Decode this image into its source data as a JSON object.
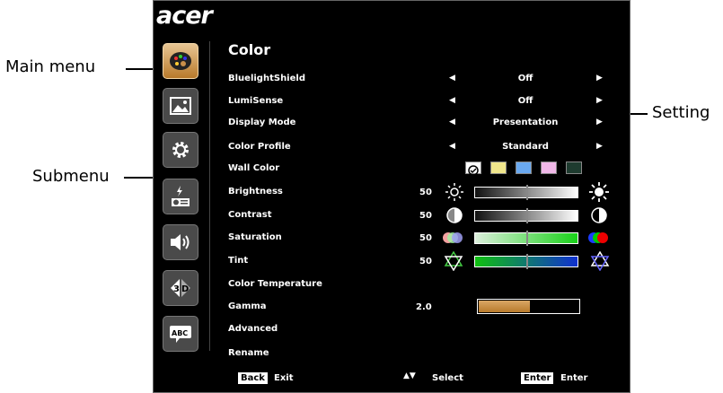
{
  "callouts": {
    "main_menu": "Main menu",
    "submenu": "Submenu",
    "setting": "Setting"
  },
  "osd": {
    "logo": "acer",
    "title": "Color",
    "nav_icons": [
      "color-palette-icon",
      "image-icon",
      "gear-icon",
      "power-settings-icon",
      "volume-icon",
      "3d-icon",
      "abc-language-icon"
    ],
    "rows": {
      "bluelight": {
        "label": "BluelightShield",
        "value": "Off"
      },
      "lumisense": {
        "label": "LumiSense",
        "value": "Off"
      },
      "display_mode": {
        "label": "Display Mode",
        "value": "Presentation"
      },
      "color_profile": {
        "label": "Color Profile",
        "value": "Standard"
      },
      "wall_color": {
        "label": "Wall Color",
        "swatches": [
          "#ffffff",
          "#f0e68c",
          "#6aa9f0",
          "#f0b8e8",
          "#1e3b2f"
        ]
      },
      "brightness": {
        "label": "Brightness",
        "value": "50",
        "level": 0.5
      },
      "contrast": {
        "label": "Contrast",
        "value": "50",
        "level": 0.5
      },
      "saturation": {
        "label": "Saturation",
        "value": "50",
        "level": 0.5
      },
      "tint": {
        "label": "Tint",
        "value": "50",
        "level": 0.5
      },
      "color_temp": {
        "label": "Color Temperature"
      },
      "gamma": {
        "label": "Gamma",
        "value": "2.0",
        "level": 0.5
      },
      "advanced": {
        "label": "Advanced"
      },
      "rename": {
        "label": "Rename"
      }
    },
    "footer": {
      "back_key": "Back",
      "back_label": "Exit",
      "select_label": "Select",
      "enter_key": "Enter",
      "enter_label": "Enter"
    }
  }
}
